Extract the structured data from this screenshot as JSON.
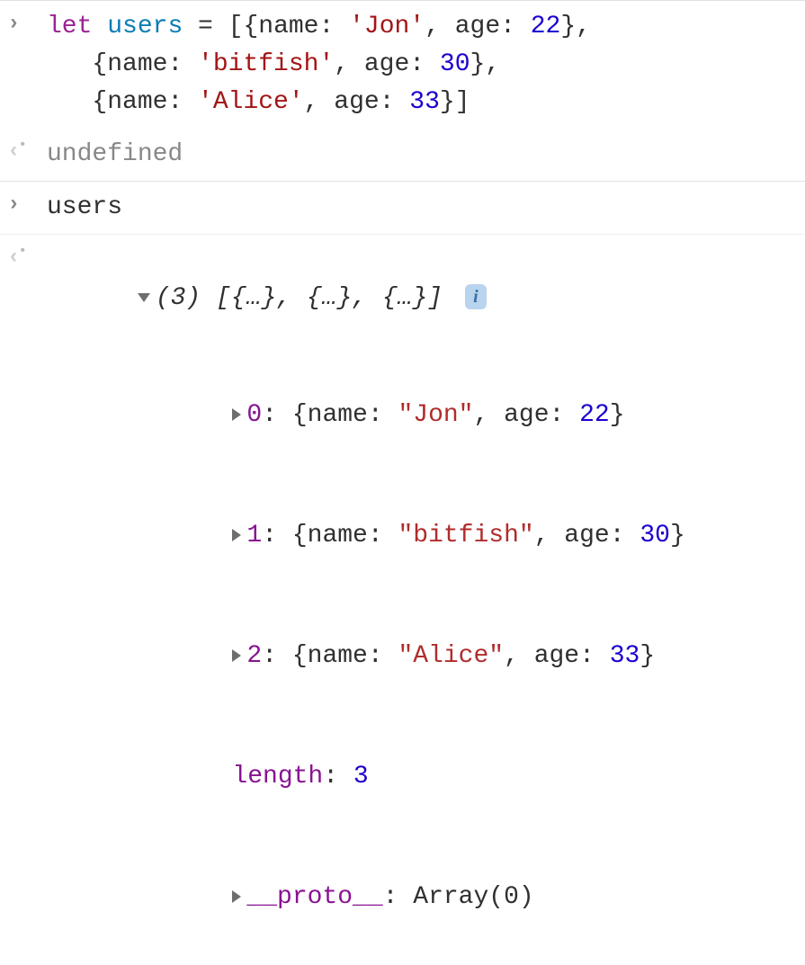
{
  "rows": [
    {
      "input_line1_keyword": "let",
      "input_line1_var": "users",
      "input_line1_eq": " = [{name: ",
      "input_line1_str": "'Jon'",
      "input_line1_age": ", age: ",
      "input_line1_num": "22",
      "input_line1_end": "},",
      "input_line2_pre": "   {name: ",
      "input_line2_str": "'bitfish'",
      "input_line2_age": ", age: ",
      "input_line2_num": "30",
      "input_line2_end": "},",
      "input_line3_pre": "   {name: ",
      "input_line3_str": "'Alice'",
      "input_line3_age": ", age: ",
      "input_line3_num": "33",
      "input_line3_end": "}]"
    },
    {
      "undefined_text": "undefined"
    },
    {
      "users_text": "users"
    },
    {
      "summary_count": "(3)",
      "summary_brackets": " [{…}, {…}, {…}] ",
      "item0_idx": "0",
      "item0_colon": ": ",
      "item0_obj_open": "{name: ",
      "item0_str": "\"Jon\"",
      "item0_mid": ", age: ",
      "item0_num": "22",
      "item0_close": "}",
      "item1_idx": "1",
      "item1_str": "\"bitfish\"",
      "item1_num": "30",
      "item2_idx": "2",
      "item2_str": "\"Alice\"",
      "item2_num": "33",
      "length_key": "length",
      "length_colon": ": ",
      "length_val": "3",
      "proto_key": "__proto__",
      "proto_colon": ": ",
      "proto_val": "Array(0)"
    }
  ],
  "info_badge": "i"
}
